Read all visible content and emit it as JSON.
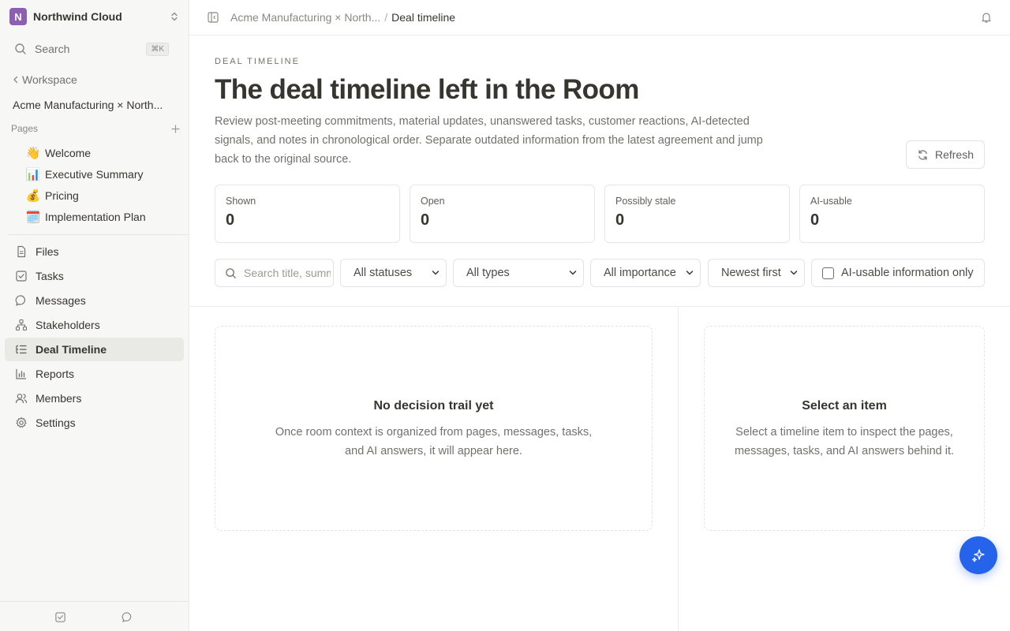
{
  "workspace": {
    "initial": "N",
    "name": "Northwind Cloud",
    "logo_color": "#8c5fb0"
  },
  "sidebar": {
    "search_label": "Search",
    "search_shortcut": "⌘K",
    "back_label": "Workspace",
    "room_name": "Acme Manufacturing × North...",
    "pages_heading": "Pages",
    "pages": [
      {
        "emoji": "👋",
        "label": "Welcome"
      },
      {
        "emoji": "📊",
        "label": "Executive Summary"
      },
      {
        "emoji": "💰",
        "label": "Pricing"
      },
      {
        "emoji": "🗓️",
        "label": "Implementation Plan"
      }
    ],
    "nav": [
      {
        "icon": "file-icon",
        "label": "Files"
      },
      {
        "icon": "task-checkbox-icon",
        "label": "Tasks"
      },
      {
        "icon": "message-icon",
        "label": "Messages"
      },
      {
        "icon": "stakeholders-icon",
        "label": "Stakeholders"
      },
      {
        "icon": "timeline-list-icon",
        "label": "Deal Timeline",
        "active": true
      },
      {
        "icon": "bar-chart-icon",
        "label": "Reports"
      },
      {
        "icon": "members-icon",
        "label": "Members"
      },
      {
        "icon": "gear-icon",
        "label": "Settings"
      }
    ]
  },
  "topbar": {
    "breadcrumb_parent": "Acme Manufacturing × North...",
    "breadcrumb_separator": "/",
    "breadcrumb_current": "Deal timeline"
  },
  "header": {
    "eyebrow": "DEAL TIMELINE",
    "title": "The deal timeline left in the Room",
    "description": "Review post-meeting commitments, material updates, unanswered tasks, customer reactions, AI-detected signals, and notes in chronological order. Separate outdated information from the latest agreement and jump back to the original source.",
    "refresh_label": "Refresh"
  },
  "stats": [
    {
      "label": "Shown",
      "value": "0"
    },
    {
      "label": "Open",
      "value": "0"
    },
    {
      "label": "Possibly stale",
      "value": "0"
    },
    {
      "label": "AI-usable",
      "value": "0"
    }
  ],
  "filters": {
    "search_placeholder": "Search title, summary",
    "status": "All statuses",
    "type": "All types",
    "importance": "All importance",
    "sort": "Newest first",
    "ai_only_label": "AI-usable information only",
    "ai_only_checked": false
  },
  "timeline_empty": {
    "heading": "No decision trail yet",
    "body": "Once room context is organized from pages, messages, tasks, and AI answers, it will appear here."
  },
  "detail_empty": {
    "heading": "Select an item",
    "body": "Select a timeline item to inspect the pages, messages, tasks, and AI answers behind it."
  },
  "colors": {
    "accent": "#2563eb",
    "sidebar_bg": "#f7f7f5",
    "active_nav_bg": "#e9e9e6"
  }
}
